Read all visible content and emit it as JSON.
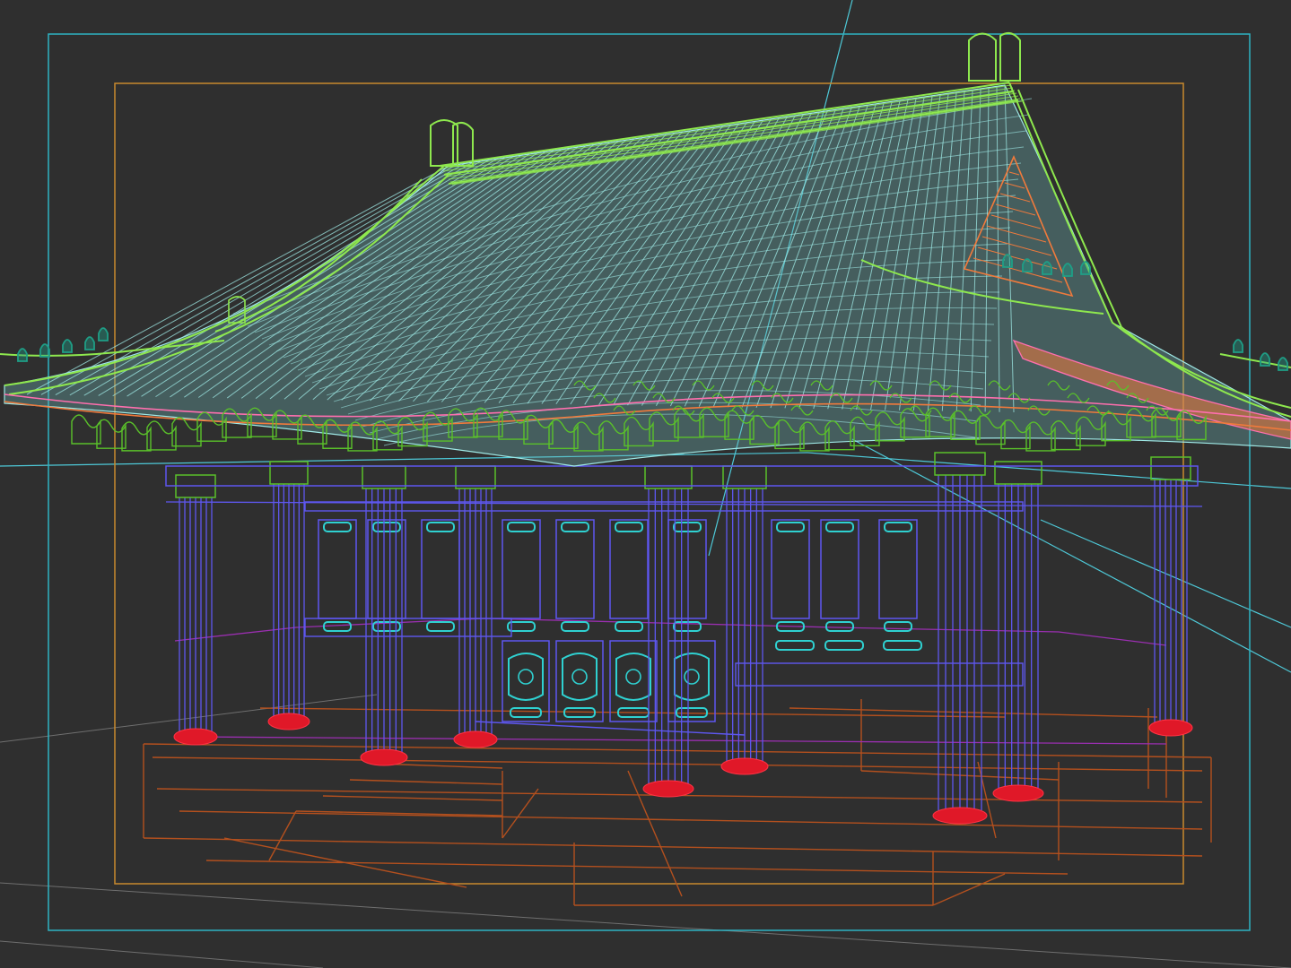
{
  "viewport": {
    "background": "#2f2f2f",
    "render_frame_color": "#2fb3c3",
    "safe_frame_color": "#c98a2e",
    "guide_line_color": "#4ec9d8"
  },
  "wireframe_colors": {
    "roof_ridge": "#8ee84e",
    "roof_tiles": "#9fe9e6",
    "roof_trim_orange": "#f07a3c",
    "roof_trim_pink": "#ff6fae",
    "bracket_green": "#5ac12a",
    "ridge_beasts": "#1f9e86",
    "columns": "#5e57f0",
    "column_bases": "#e01828",
    "window_panels": "#2fd1d1",
    "platform": "#b4501e",
    "floor_line": "#9a2fb0"
  },
  "icons": {
    "viewport_camera": "camera-icon"
  }
}
